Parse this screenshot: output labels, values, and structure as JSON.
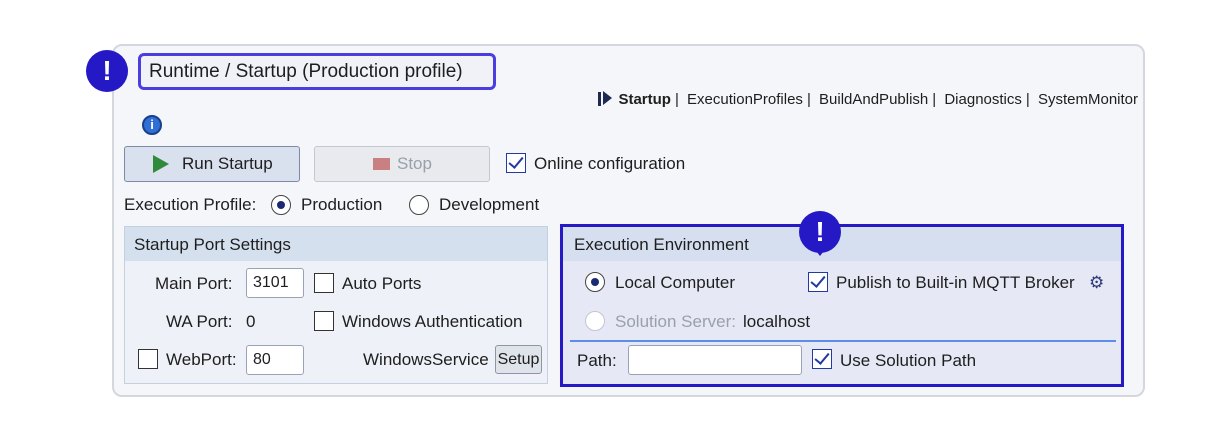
{
  "title": "Runtime / Startup (Production profile)",
  "alert_glyph": "!",
  "nav": {
    "current": "Startup",
    "links": [
      "ExecutionProfiles",
      "BuildAndPublish",
      "Diagnostics",
      "SystemMonitor"
    ],
    "separator": "|"
  },
  "info_glyph": "i",
  "toolbar": {
    "run_label": "Run Startup",
    "stop_label": "Stop",
    "online_label": "Online configuration",
    "online_checked": true
  },
  "profile": {
    "label": "Execution Profile:",
    "options": [
      "Production",
      "Development"
    ],
    "selected": "Production"
  },
  "port_settings": {
    "title": "Startup Port Settings",
    "main_port_label": "Main Port:",
    "main_port_value": "3101",
    "auto_ports_label": "Auto Ports",
    "wa_port_label": "WA Port:",
    "wa_port_value": "0",
    "windows_auth_label": "Windows Authentication",
    "webport_label": "WebPort:",
    "webport_value": "80",
    "windows_service_label": "WindowsService",
    "setup_label": "Setup"
  },
  "environment": {
    "title": "Execution Environment",
    "local_label": "Local Computer",
    "publish_label": "Publish to Built-in MQTT Broker",
    "publish_checked": true,
    "solution_server_label": "Solution Server:",
    "solution_server_value": "localhost",
    "path_label": "Path:",
    "path_value": "",
    "use_solution_path_label": "Use Solution Path",
    "use_solution_path_checked": true
  },
  "colors": {
    "accent": "#2419c4",
    "panel_bg": "#f4f6fa",
    "group_header": "#d5e0ef"
  }
}
